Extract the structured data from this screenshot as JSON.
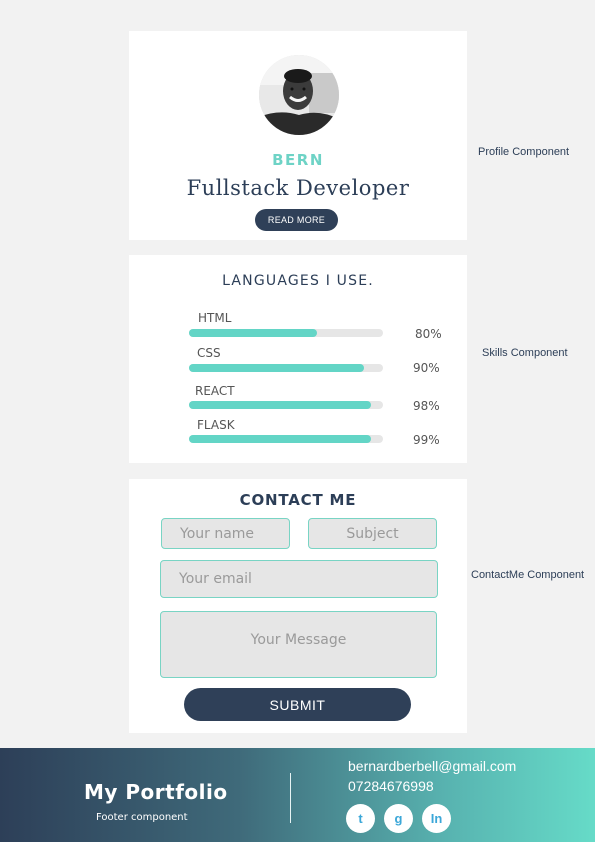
{
  "profile": {
    "name": "BERN",
    "role": "Fullstack Developer",
    "read_more": "READ MORE",
    "side_label": "Profile Component"
  },
  "skills": {
    "title": "LANGUAGES I USE.",
    "side_label": "Skills Component",
    "items": [
      {
        "name": "HTML",
        "percent_label": "80%",
        "fill": 0.66
      },
      {
        "name": "CSS",
        "percent_label": "90%",
        "fill": 0.9
      },
      {
        "name": "REACT",
        "percent_label": "98%",
        "fill": 0.94
      },
      {
        "name": "FLASK",
        "percent_label": "99%",
        "fill": 0.94
      }
    ]
  },
  "contact": {
    "title": "CONTACT ME",
    "name_placeholder": "Your name",
    "subject_placeholder": "Subject",
    "email_placeholder": "Your email",
    "message_placeholder": "Your Message",
    "submit_label": "SUBMIT",
    "side_label": "ContactMe Component"
  },
  "footer": {
    "brand": "My Portfolio",
    "subtitle": "Footer component",
    "email": "bernardberbell@gmail.com",
    "phone": "07284676998",
    "social": [
      {
        "icon": "twitter-icon",
        "label": "t"
      },
      {
        "icon": "google-icon",
        "label": "g"
      },
      {
        "icon": "linkedin-icon",
        "label": "In"
      }
    ]
  },
  "colors": {
    "accent": "#63d5c6",
    "navy": "#2f4058",
    "background": "#f2f2f2"
  }
}
